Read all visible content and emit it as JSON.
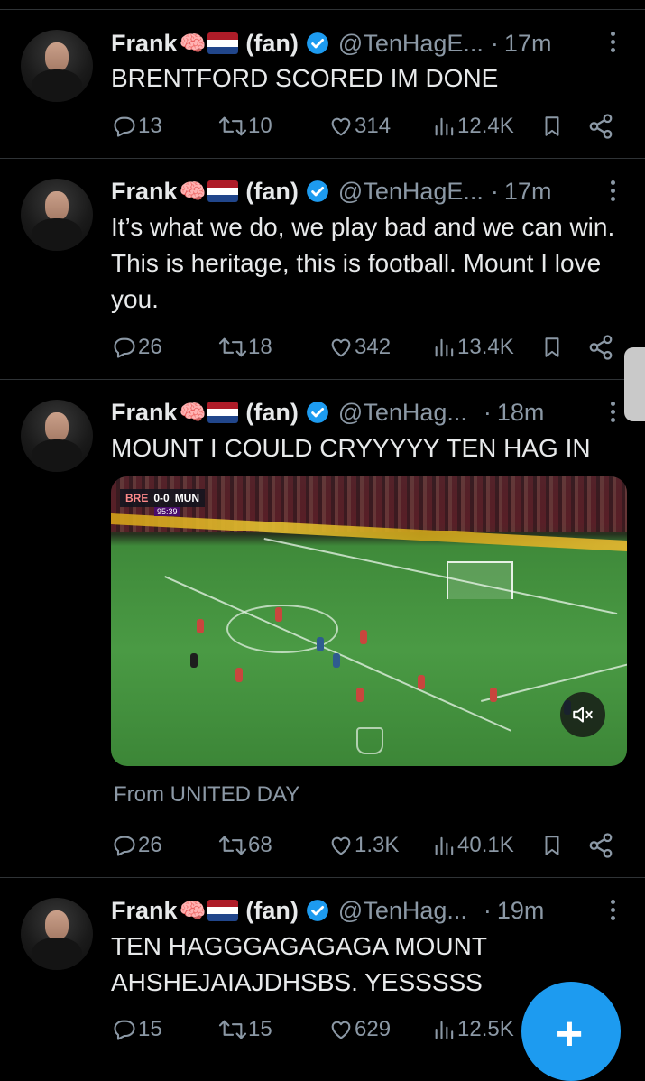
{
  "tweets": [
    {
      "name": "Frank",
      "suffix": "(fan)",
      "handle": "@TenHagE...",
      "time": "17m",
      "text": "BRENTFORD SCORED IM DONE",
      "replies": "13",
      "retweets": "10",
      "likes": "314",
      "views": "12.4K"
    },
    {
      "name": "Frank",
      "suffix": "(fan)",
      "handle": "@TenHagE...",
      "time": "17m",
      "text": "It’s what we do, we play bad and we can win. This is heritage, this is football. Mount I love you.",
      "replies": "26",
      "retweets": "18",
      "likes": "342",
      "views": "13.4K"
    },
    {
      "name": "Frank",
      "suffix": "(fan)",
      "handle": "@TenHag...",
      "time": "18m",
      "text": "MOUNT I COULD CRYYYYY TEN HAG IN",
      "media": {
        "scorebug_home": "BRE",
        "scorebug_score": "0-0",
        "scorebug_away": "MUN",
        "scorebug_clock": "95:39"
      },
      "from": "From UNITED DAY",
      "replies": "26",
      "retweets": "68",
      "likes": "1.3K",
      "views": "40.1K"
    },
    {
      "name": "Frank",
      "suffix": "(fan)",
      "handle": "@TenHag...",
      "time": "19m",
      "text": "TEN HAGGGAGAGAGA MOUNT AHSHEJAIAJDHSBS. YESSSSS",
      "replies": "15",
      "retweets": "15",
      "likes": "629",
      "views": "12.5K"
    }
  ],
  "icons": {
    "brain": "brain-emoji",
    "flag": "netherlands-flag",
    "verified": "verified-badge",
    "reply": "reply-icon",
    "retweet": "retweet-icon",
    "like": "heart-icon",
    "views": "views-icon",
    "bookmark": "bookmark-icon",
    "share": "share-icon"
  },
  "fab": {
    "label": "+"
  },
  "colors": {
    "background": "#000000",
    "text": "#e7e9ea",
    "muted": "#8b98a5",
    "accent": "#1d9bf0",
    "divider": "#2f3336"
  }
}
